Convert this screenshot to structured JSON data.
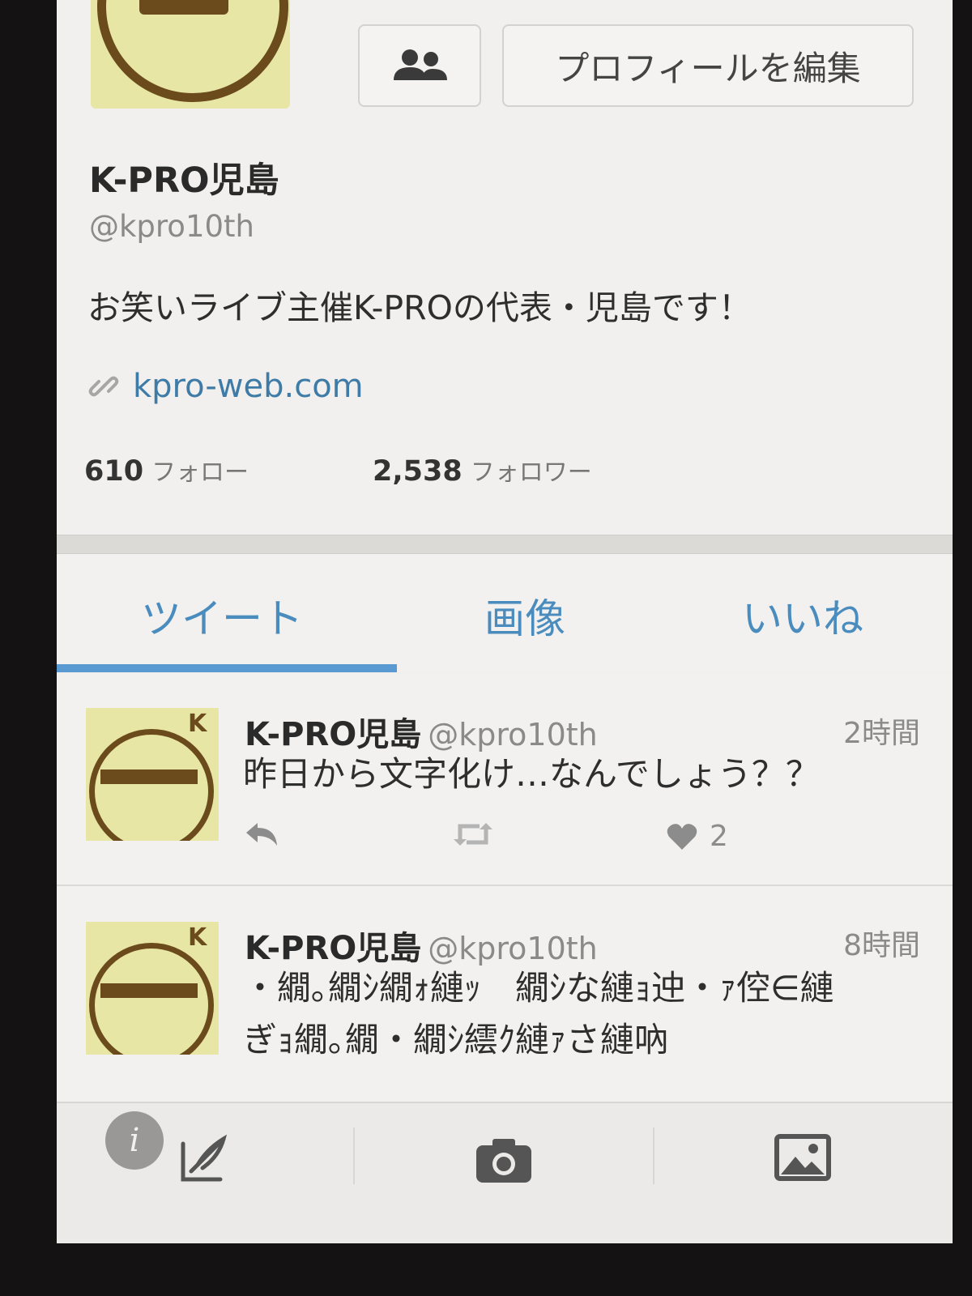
{
  "profile": {
    "name": "K-PRO児島",
    "handle": "@kpro10th",
    "bio": "お笑いライブ主催K-PROの代表・児島です！",
    "link": "kpro-web.com",
    "edit_button": "プロフィールを編集",
    "follow_count": "610",
    "follow_label": "フォロー",
    "follower_count": "2,538",
    "follower_label": "フォロワー"
  },
  "tabs": {
    "tweets": "ツイート",
    "media": "画像",
    "likes": "いいね"
  },
  "tweets": [
    {
      "name": "K-PRO児島",
      "handle": "@kpro10th",
      "time": "2時間",
      "line1": "昨日から文字化け…なんでしょう？？",
      "line2": "",
      "like_count": "2"
    },
    {
      "name": "K-PRO児島",
      "handle": "@kpro10th",
      "time": "8時間",
      "line1": "・繝｡繝ｼ繝ｫ縺ｯ　繝ｼな縺ｮ迚・ｧ倥∈縺",
      "line2": "ぎｮ繝｡繝・繝ｼ繧ｸ縺ｧさ縺吶",
      "like_count": ""
    }
  ],
  "info_badge": "i",
  "colors": {
    "accent": "#4a8cbd",
    "avatar_bg": "#e8e6a4",
    "avatar_ring": "#6b4a1c"
  }
}
